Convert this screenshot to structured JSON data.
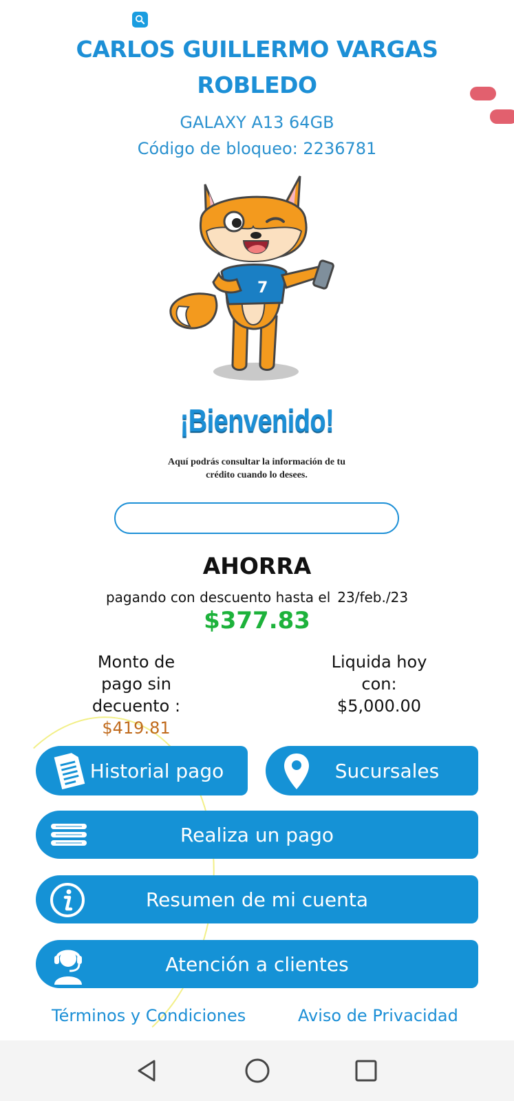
{
  "header": {
    "name": "CARLOS GUILLERMO VARGAS ROBLEDO",
    "device": "GALAXY A13 64GB",
    "lock_code": "Código de bloqueo: 2236781"
  },
  "welcome": {
    "title": "¡Bienvenido!",
    "subtitle": "Aquí podrás consultar la información de tu crédito cuando lo desees."
  },
  "mascot": {
    "shirt_text": "7"
  },
  "savings": {
    "title": "AHORRA",
    "subtitle": "pagando con descuento hasta el",
    "date": "23/feb./23",
    "amount": "$377.83",
    "amount_color": "#1db23b"
  },
  "summary": {
    "left_label": "Monto de pago sin decuento :",
    "left_value": "$419.81",
    "right_label": "Liquida hoy con:",
    "right_value": "$5,000.00"
  },
  "buttons": {
    "history": "Historial pago",
    "branches": "Sucursales",
    "pay": "Realiza un pago",
    "summary": "Resumen de mi cuenta",
    "support": "Atención a clientes"
  },
  "footer": {
    "terms": "Términos y Condiciones",
    "privacy": "Aviso de Privacidad"
  },
  "icons": {
    "search": "search-icon",
    "history": "document-icon",
    "branches": "location-pin-icon",
    "pay": "stack-icon",
    "summary": "info-icon",
    "support": "headset-agent-icon",
    "nav_back": "back-triangle-icon",
    "nav_home": "home-circle-icon",
    "nav_recent": "recents-square-icon"
  },
  "colors": {
    "primary": "#1592d6",
    "accent_orange": "#c06a1c"
  }
}
